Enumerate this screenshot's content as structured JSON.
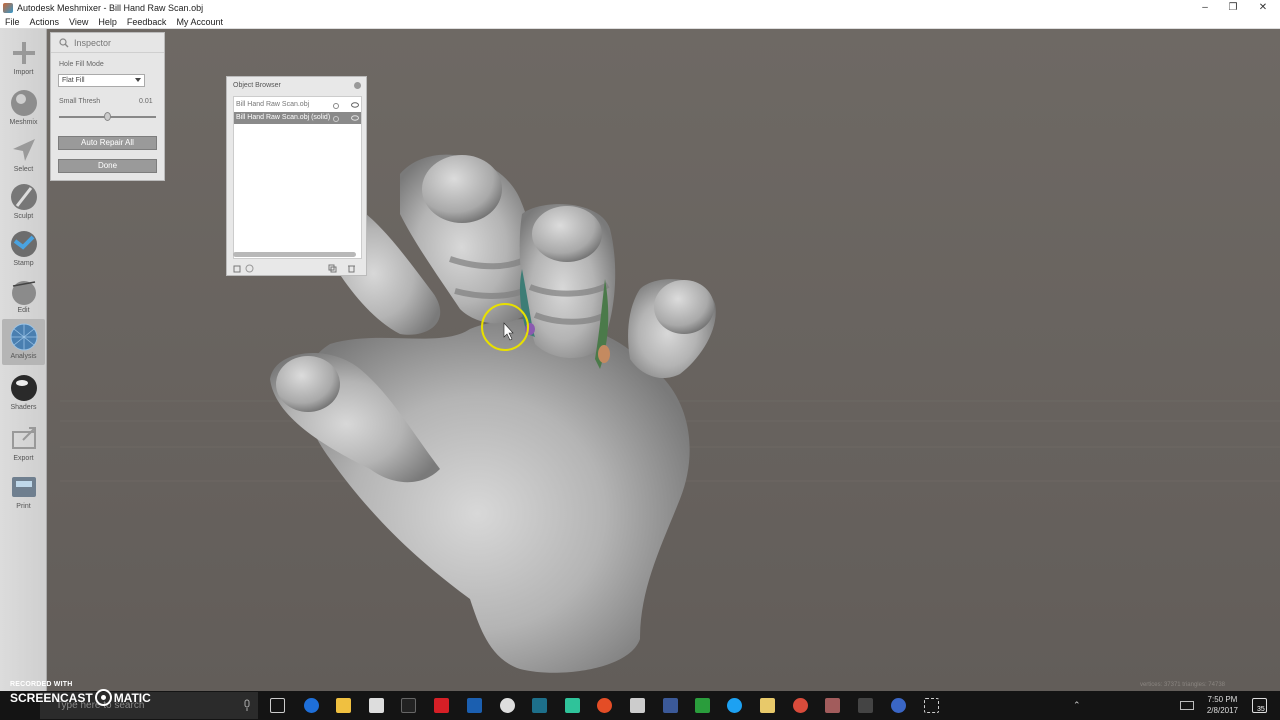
{
  "window": {
    "title": "Autodesk Meshmixer - Bill Hand Raw Scan.obj"
  },
  "menu": [
    "File",
    "Actions",
    "View",
    "Help",
    "Feedback",
    "My Account"
  ],
  "toolbar": [
    {
      "label": "Import",
      "icon": "plus-icon"
    },
    {
      "label": "Meshmix",
      "icon": "meshmix-sphere-icon"
    },
    {
      "label": "Select",
      "icon": "select-arrow-icon"
    },
    {
      "label": "Sculpt",
      "icon": "sculpt-brush-icon"
    },
    {
      "label": "Stamp",
      "icon": "stamp-icon"
    },
    {
      "label": "Edit",
      "icon": "edit-sphere-icon"
    },
    {
      "label": "Analysis",
      "icon": "analysis-sphere-icon",
      "active": true
    },
    {
      "label": "Shaders",
      "icon": "shaders-ball-icon"
    },
    {
      "label": "Export",
      "icon": "export-icon"
    },
    {
      "label": "Print",
      "icon": "printer-icon"
    }
  ],
  "inspector": {
    "title": "Inspector",
    "hole_fill_label": "Hole Fill Mode",
    "hole_fill_value": "Flat Fill",
    "small_thresh_label": "Small Thresh",
    "small_thresh_value": "0.01",
    "small_thresh_level": 0.5,
    "auto_repair_label": "Auto Repair All",
    "done_label": "Done"
  },
  "object_browser": {
    "title": "Object Browser",
    "items": [
      {
        "name": "Bill Hand Raw Scan.obj",
        "selected": false
      },
      {
        "name": "Bill Hand Raw Scan.obj (solid)",
        "selected": true
      }
    ]
  },
  "status": {
    "text": "vertices: 37371 triangles: 74738"
  },
  "taskbar": {
    "search_placeholder": "Type here to search",
    "time": "7:50 PM",
    "date": "2/8/2017",
    "notification_count": "35"
  },
  "watermark": {
    "recorded_with": "RECORDED WITH",
    "brand_left": "SCREENCAST",
    "brand_right": "MATIC"
  }
}
